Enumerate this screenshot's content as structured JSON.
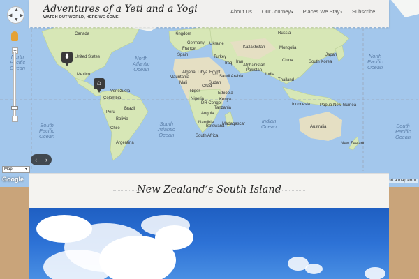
{
  "site": {
    "title": "Adventures of a Yeti and a Yogi",
    "tagline": "WATCH OUT WORLD, HERE WE COME!"
  },
  "nav": [
    {
      "label": "About Us",
      "has_submenu": false
    },
    {
      "label": "Our Journey",
      "has_submenu": true
    },
    {
      "label": "Places We Stay",
      "has_submenu": true
    },
    {
      "label": "Subscribe",
      "has_submenu": false
    }
  ],
  "map": {
    "type_label": "Map",
    "logo": "Google",
    "report_link": "port a map error",
    "ocean_labels": [
      {
        "text": "North\nPacific\nOcean",
        "pos": "left-top"
      },
      {
        "text": "North\nAtlantic\nOcean"
      },
      {
        "text": "South\nAtlantic\nOcean"
      },
      {
        "text": "South\nPacific\nOcean"
      },
      {
        "text": "Indian\nOcean"
      },
      {
        "text": "North\nPacific\nOcean",
        "pos": "right"
      },
      {
        "text": "South\nPacific\nOcean",
        "pos": "right"
      }
    ],
    "country_labels": [
      "Canada",
      "United States",
      "Mexico",
      "Venezuela",
      "Colombia",
      "Peru",
      "Brazil",
      "Bolivia",
      "Chile",
      "Argentina",
      "Kingdom",
      "Germany",
      "France",
      "Spain",
      "Ukraine",
      "Turkey",
      "Kazakhstan",
      "Russia",
      "Mongolia",
      "China",
      "Iran",
      "Afghanistan",
      "Pakistan",
      "India",
      "Iraq",
      "Saudi Arabia",
      "Egypt",
      "Libya",
      "Algeria",
      "Mali",
      "Niger",
      "Chad",
      "Sudan",
      "Nigeria",
      "Ethiopia",
      "Kenya",
      "Tanzania",
      "DR Congo",
      "Angola",
      "Namibia",
      "Botswana",
      "South Africa",
      "Madagascar",
      "Thailand",
      "Indonesia",
      "Papua New Guinea",
      "Australia",
      "New Zealand",
      "Japan",
      "South Korea",
      "Mauritania"
    ],
    "markers": [
      {
        "name": "download-marker",
        "glyph": "⬇"
      },
      {
        "name": "hotel-marker",
        "glyph": "⌂"
      }
    ],
    "controls": {
      "zoom_in": "+",
      "zoom_out": "−",
      "prev": "‹",
      "next": "›"
    }
  },
  "post": {
    "title": "New Zealand’s South Island"
  },
  "colors": {
    "ocean": "#a3c7ec",
    "land": "#d7e7b6",
    "paper": "#f1f0ee",
    "background": "#c8a67e",
    "sky": "#2d72d6"
  }
}
